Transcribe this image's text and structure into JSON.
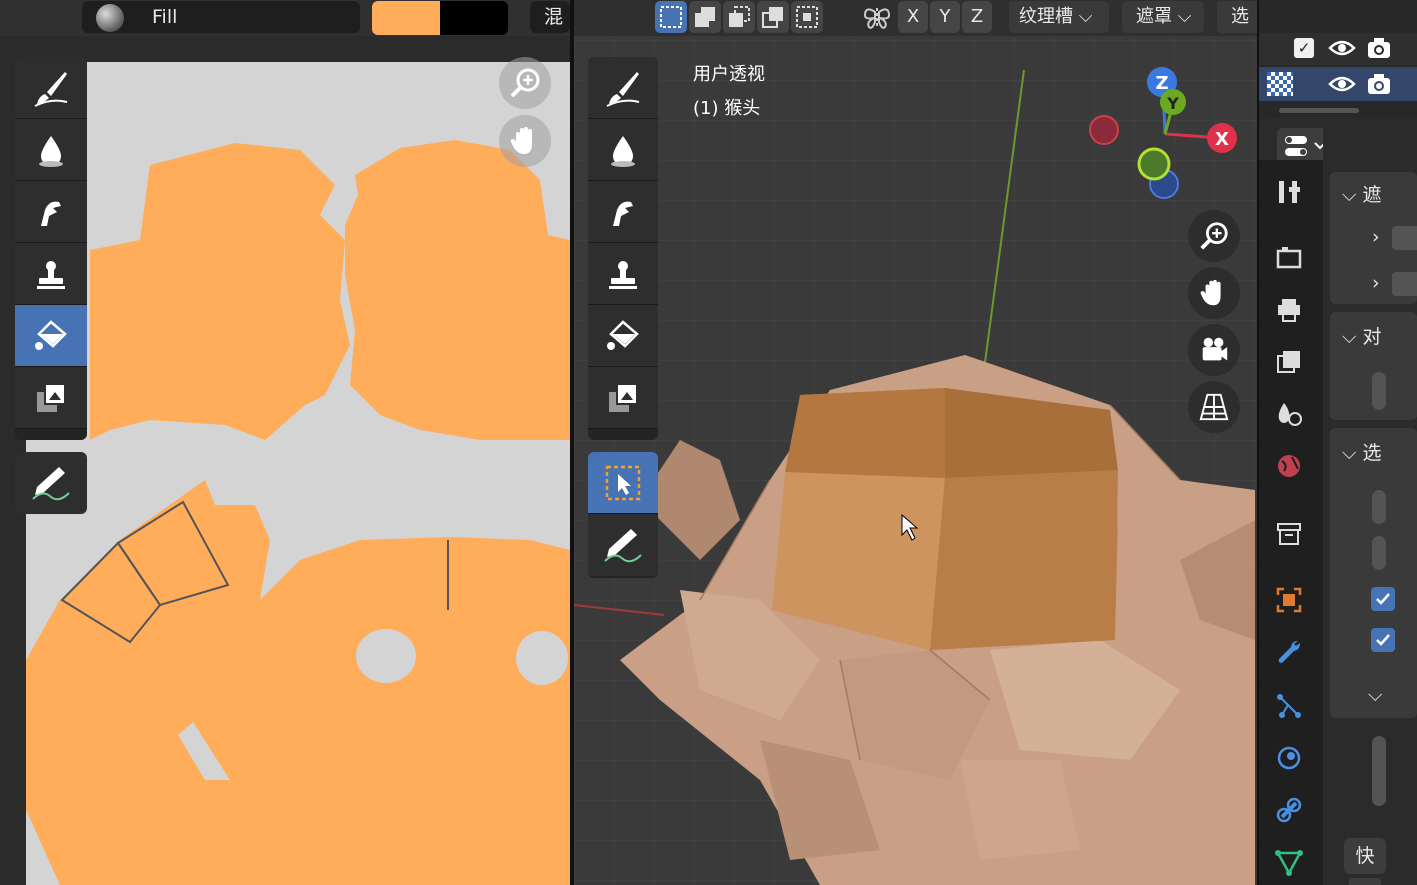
{
  "uv_editor": {
    "brush_name": "Fill",
    "colors": {
      "primary": "#ffad5a",
      "secondary": "#000000"
    },
    "blend_label": "混",
    "tools": [
      "draw-brush",
      "soften-brush",
      "smear-brush",
      "clone-brush",
      "fill-brush",
      "mask-brush"
    ],
    "annotate_tool": "annotate"
  },
  "viewport": {
    "select_modes": [
      "set",
      "extend",
      "subtract",
      "invert",
      "intersect"
    ],
    "axes": [
      "X",
      "Y",
      "Z"
    ],
    "menus": {
      "texture_slot": "纹理槽",
      "mask": "遮罩",
      "select": "选"
    },
    "view_name": "用户透视",
    "object_name": "(1) 猴头",
    "gizmo": {
      "x": "X",
      "y": "Y",
      "z": "Z"
    },
    "accent": "#4772b3"
  },
  "properties": {
    "section_labels": [
      "遮",
      "对",
      "选"
    ],
    "quick_label": "快"
  }
}
